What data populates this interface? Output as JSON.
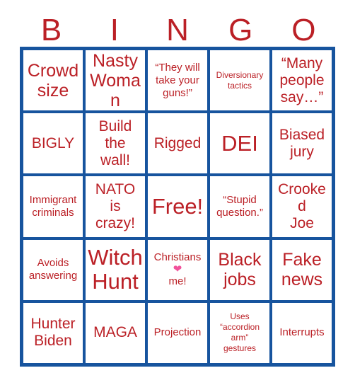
{
  "card": {
    "title": "Bingo Card",
    "colors": {
      "grid_blue": "#17549e",
      "text_red": "#bb2026",
      "heart_pink": "#f2529c",
      "cell_background": "#ffffff"
    }
  },
  "header": {
    "letters": [
      "B",
      "I",
      "N",
      "G",
      "O"
    ]
  },
  "grid": {
    "columns": 5,
    "rows": 5,
    "cells": [
      {
        "text": "Crowd\nsize",
        "size": "lg",
        "row": 1,
        "col": 1
      },
      {
        "text": "Nasty\nWoman",
        "size": "lg",
        "row": 1,
        "col": 2
      },
      {
        "text": "“They will\ntake your\nguns!”",
        "size": "sm",
        "row": 1,
        "col": 3
      },
      {
        "text": "Diversionary\ntactics",
        "size": "xs",
        "row": 1,
        "col": 4
      },
      {
        "text": "“Many\npeople\nsay…”",
        "size": "md",
        "row": 1,
        "col": 5
      },
      {
        "text": "BIGLY",
        "size": "md",
        "row": 2,
        "col": 1
      },
      {
        "text": "Build\nthe\nwall!",
        "size": "md",
        "row": 2,
        "col": 2
      },
      {
        "text": "Rigged",
        "size": "md",
        "row": 2,
        "col": 3
      },
      {
        "text": "DEI",
        "size": "xl",
        "row": 2,
        "col": 4
      },
      {
        "text": "Biased\njury",
        "size": "md",
        "row": 2,
        "col": 5
      },
      {
        "text": "Immigrant\ncriminals",
        "size": "sm",
        "row": 3,
        "col": 1
      },
      {
        "text": "NATO\nis\ncrazy!",
        "size": "md",
        "row": 3,
        "col": 2
      },
      {
        "text": "Free!",
        "size": "xl",
        "row": 3,
        "col": 3
      },
      {
        "text": "“Stupid\nquestion.”",
        "size": "sm",
        "row": 3,
        "col": 4
      },
      {
        "text": "Crooked\nJoe",
        "size": "md",
        "row": 3,
        "col": 5
      },
      {
        "text": "Avoids\nanswering",
        "size": "sm",
        "row": 4,
        "col": 1
      },
      {
        "text": "Witch\nHunt",
        "size": "xl",
        "row": 4,
        "col": 2
      },
      {
        "text": "",
        "size": "sm",
        "row": 4,
        "col": 3,
        "special": "christians-heart-me"
      },
      {
        "text": "Black\njobs",
        "size": "lg",
        "row": 4,
        "col": 4
      },
      {
        "text": "Fake\nnews",
        "size": "lg",
        "row": 4,
        "col": 5
      },
      {
        "text": "Hunter\nBiden",
        "size": "md",
        "row": 5,
        "col": 1
      },
      {
        "text": "MAGA",
        "size": "md",
        "row": 5,
        "col": 2
      },
      {
        "text": "Projection",
        "size": "sm",
        "row": 5,
        "col": 3
      },
      {
        "text": "Uses\n“accordion\narm”\ngestures",
        "size": "xs",
        "row": 5,
        "col": 4
      },
      {
        "text": "Interrupts",
        "size": "sm",
        "row": 5,
        "col": 5
      }
    ],
    "heart_cell": {
      "line1": "Christians",
      "heart_icon": "heart-icon",
      "heart_glyph": "❤",
      "line2": "me!"
    }
  }
}
